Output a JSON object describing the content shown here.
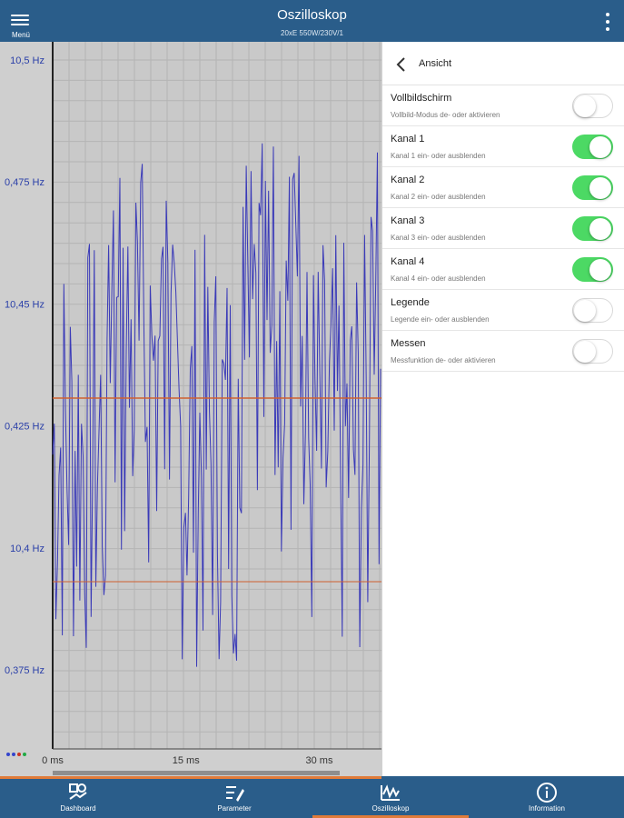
{
  "header": {
    "menu_label": "Menü",
    "title": "Oszilloskop",
    "subtitle": "20xE 550W/230V/1"
  },
  "scope": {
    "y_labels": [
      "10,5 Hz",
      "0,475 Hz",
      "10,45 Hz",
      "0,425 Hz",
      "10,4 Hz",
      "0,375 Hz"
    ],
    "x_labels": [
      "0 ms",
      "15 ms",
      "30 ms"
    ],
    "y_range": [
      10.37,
      10.5
    ],
    "x_range": [
      0,
      37
    ],
    "legend_dots": [
      "#3344cc",
      "#3344cc",
      "#cc3322",
      "#22aa44"
    ],
    "signal_color": "#3a3ab8",
    "cursor_color": "#d06030",
    "grid": true
  },
  "panel": {
    "title": "Ansicht",
    "settings": [
      {
        "label": "Vollbildschirm",
        "desc": "Vollbild-Modus de- oder aktivieren",
        "on": false
      },
      {
        "label": "Kanal 1",
        "desc": "Kanal 1 ein- oder ausblenden",
        "on": true
      },
      {
        "label": "Kanal 2",
        "desc": "Kanal 2 ein- oder ausblenden",
        "on": true
      },
      {
        "label": "Kanal 3",
        "desc": "Kanal 3 ein- oder ausblenden",
        "on": true
      },
      {
        "label": "Kanal 4",
        "desc": "Kanal 4 ein- oder ausblenden",
        "on": true
      },
      {
        "label": "Legende",
        "desc": "Legende ein- oder ausblenden",
        "on": false
      },
      {
        "label": "Messen",
        "desc": "Messfunktion de- oder aktivieren",
        "on": false
      }
    ]
  },
  "nav": [
    {
      "label": "Dashboard",
      "icon": "dashboard-icon",
      "active": false
    },
    {
      "label": "Parameter",
      "icon": "parameter-icon",
      "active": false
    },
    {
      "label": "Oszilloskop",
      "icon": "oscilloscope-icon",
      "active": true
    },
    {
      "label": "Information",
      "icon": "info-icon",
      "active": false
    }
  ],
  "colors": {
    "primary": "#2a5d8a",
    "accent": "#e07b39",
    "toggle_on": "#4cd964"
  }
}
